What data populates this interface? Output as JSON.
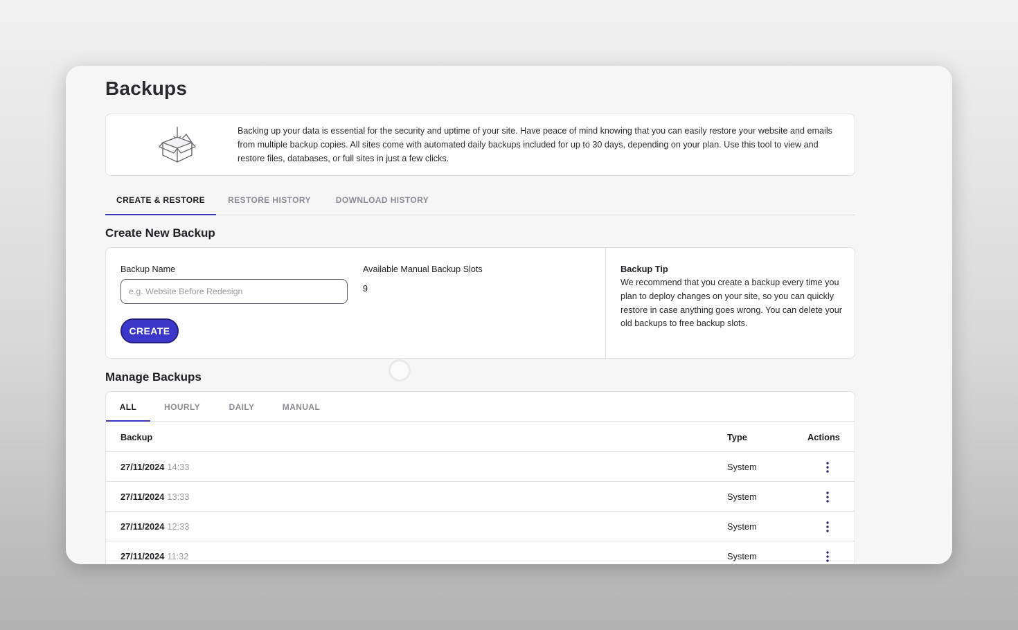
{
  "page": {
    "title": "Backups"
  },
  "info": {
    "icon": "package-download-icon",
    "text": "Backing up your data is essential for the security and uptime of your site. Have peace of mind knowing that you can easily restore your website and emails from multiple backup copies. All sites come with automated daily backups included for up to 30 days, depending on your plan. Use this tool to view and restore files, databases, or full sites in just a few clicks."
  },
  "tabs": [
    {
      "label": "CREATE & RESTORE",
      "active": true
    },
    {
      "label": "RESTORE HISTORY",
      "active": false
    },
    {
      "label": "DOWNLOAD HISTORY",
      "active": false
    }
  ],
  "create": {
    "section_title": "Create New Backup",
    "name_label": "Backup Name",
    "name_value": "",
    "name_placeholder": "e.g. Website Before Redesign",
    "slots_label": "Available Manual Backup Slots",
    "slots_value": "9",
    "button_label": "CREATE",
    "tip_title": "Backup Tip",
    "tip_text": "We recommend that you create a backup every time you plan to deploy changes on your site, so you can quickly restore in case anything goes wrong. You can delete your old backups to free backup slots."
  },
  "manage": {
    "section_title": "Manage Backups",
    "filters": [
      {
        "label": "ALL",
        "active": true
      },
      {
        "label": "HOURLY",
        "active": false
      },
      {
        "label": "DAILY",
        "active": false
      },
      {
        "label": "MANUAL",
        "active": false
      }
    ],
    "columns": {
      "backup": "Backup",
      "type": "Type",
      "actions": "Actions"
    },
    "rows": [
      {
        "date": "27/11/2024",
        "time": "14:33",
        "type": "System"
      },
      {
        "date": "27/11/2024",
        "time": "13:33",
        "type": "System"
      },
      {
        "date": "27/11/2024",
        "time": "12:33",
        "type": "System"
      },
      {
        "date": "27/11/2024",
        "time": "11:32",
        "type": "System"
      }
    ]
  },
  "colors": {
    "accent": "#3d37c9",
    "tab_underline": "#3b37b8",
    "muted_text": "#8c8c94"
  }
}
